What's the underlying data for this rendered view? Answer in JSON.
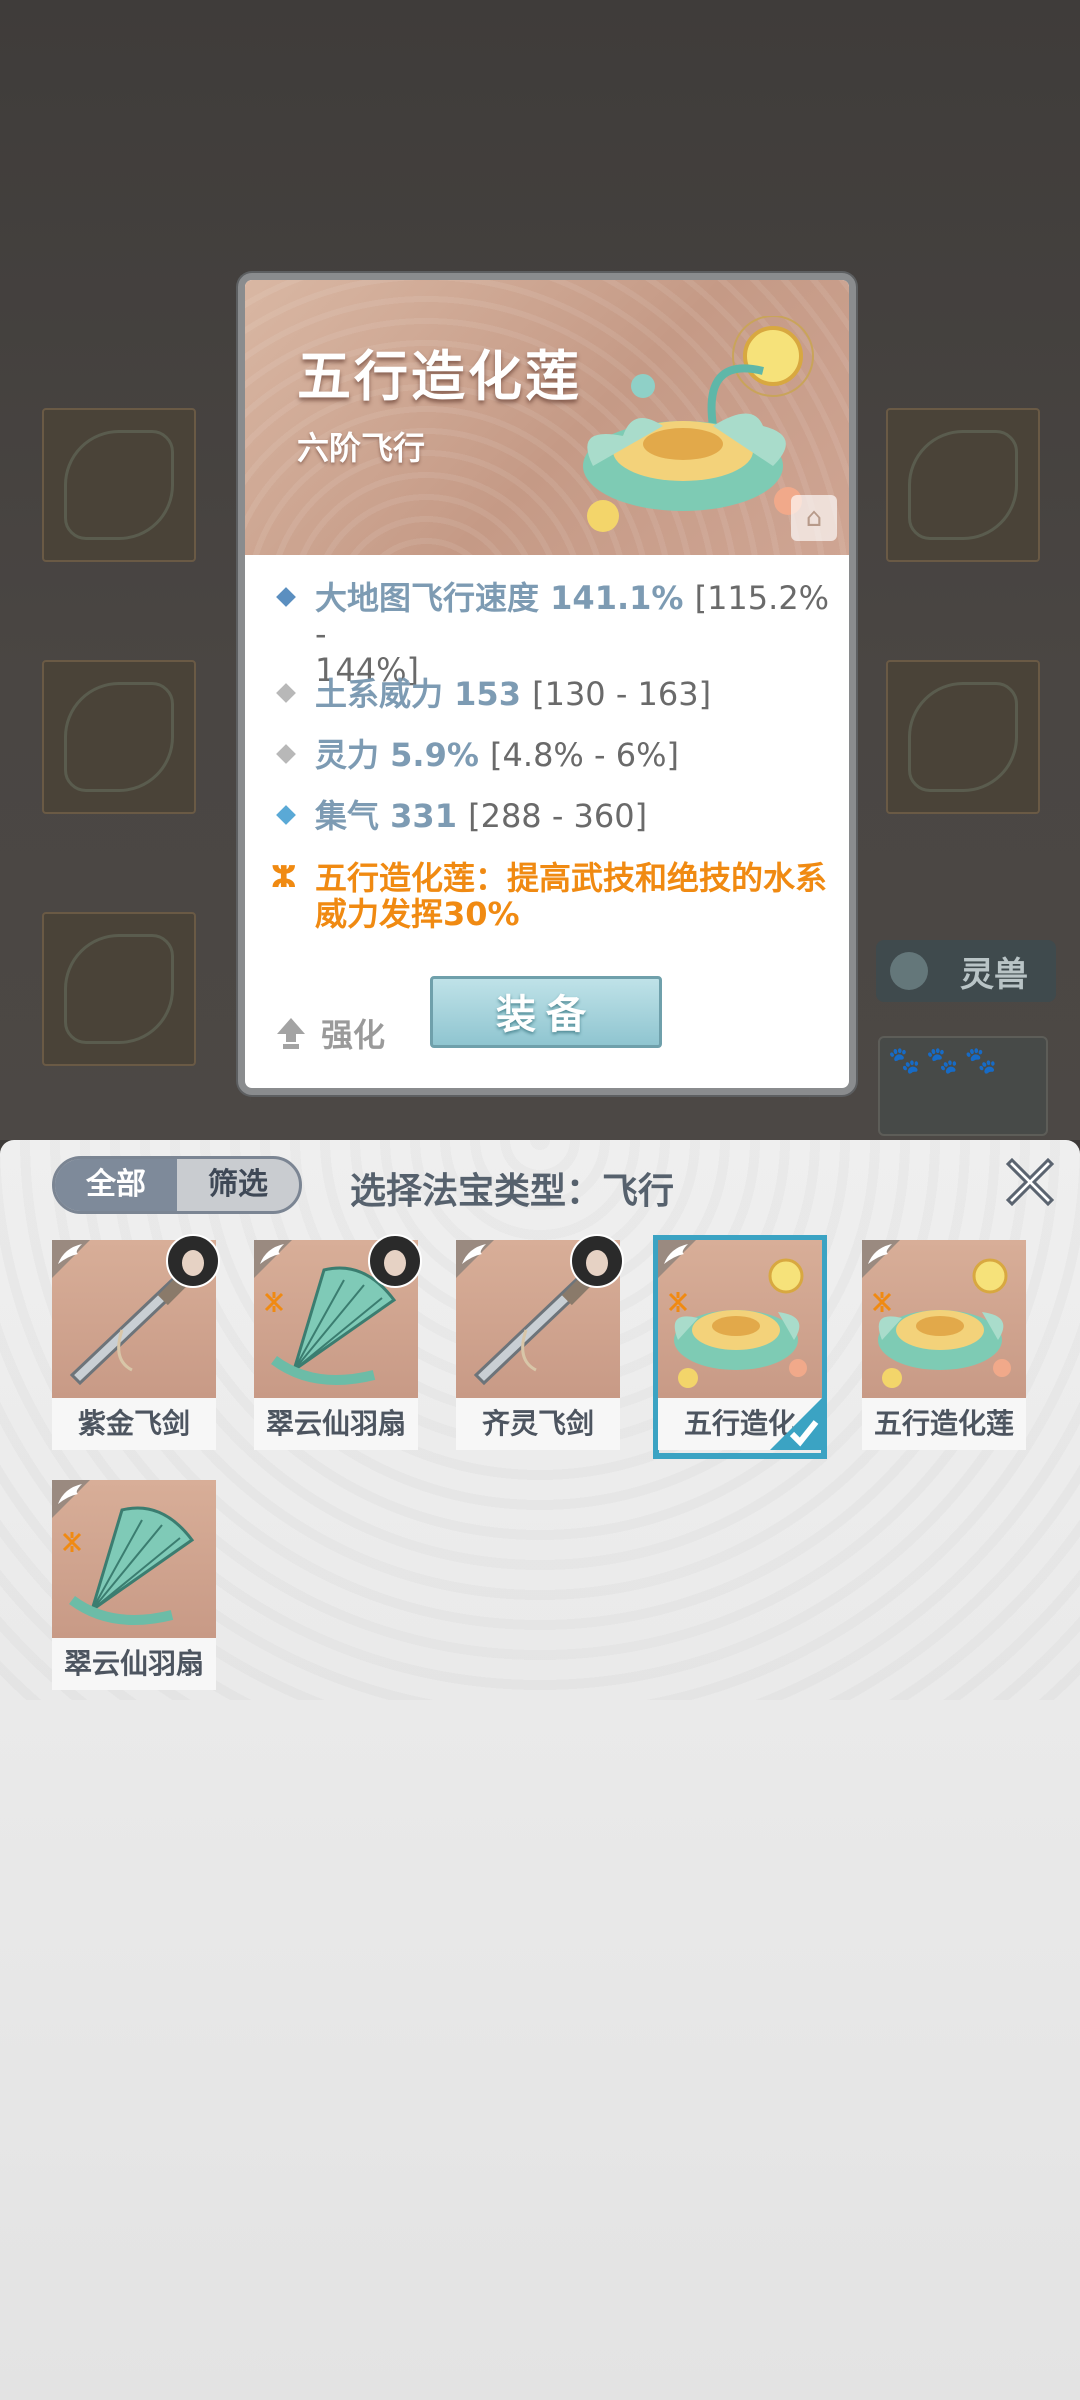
{
  "item_detail": {
    "name": "五行造化莲",
    "tier": "六阶飞行",
    "stats": [
      {
        "label": "大地图飞行速度",
        "value": "141.1%",
        "range": "[115.2% -",
        "range2": "144%]",
        "color": "#5b8fc0"
      },
      {
        "label": "土系威力",
        "value": "153",
        "range": "[130 - 163]",
        "color": "#b8b8b8"
      },
      {
        "label": "灵力",
        "value": "5.9%",
        "range": "[4.8% - 6%]",
        "color": "#b8b8b8"
      },
      {
        "label": "集气",
        "value": "331",
        "range": "[288 - 360]",
        "color": "#5aa9d6"
      }
    ],
    "special_line1": "五行造化莲：提高武技和绝技的水系",
    "special_line2": "威力发挥30%",
    "strengthen_label": "强化",
    "equip_label": "装备"
  },
  "background": {
    "pet_label": "灵兽"
  },
  "panel": {
    "tabs": [
      "全部",
      "筛选"
    ],
    "title": "选择法宝类型：飞行",
    "items": [
      {
        "name": "紫金飞剑",
        "art": "sword",
        "avatar": true,
        "element": false,
        "selected": false
      },
      {
        "name": "翠云仙羽扇",
        "art": "fan",
        "avatar": true,
        "element": true,
        "selected": false
      },
      {
        "name": "齐灵飞剑",
        "art": "sword",
        "avatar": true,
        "element": false,
        "selected": false
      },
      {
        "name": "五行造化",
        "art": "lotus",
        "avatar": false,
        "element": true,
        "selected": true
      },
      {
        "name": "五行造化莲",
        "art": "lotus",
        "avatar": false,
        "element": true,
        "selected": false
      },
      {
        "name": "翠云仙羽扇",
        "art": "fan",
        "avatar": false,
        "element": true,
        "selected": false
      }
    ]
  },
  "colors": {
    "accent_blue": "#3ba3c3",
    "special_orange": "#f08a12",
    "stat_value": "#7d9bb3"
  }
}
